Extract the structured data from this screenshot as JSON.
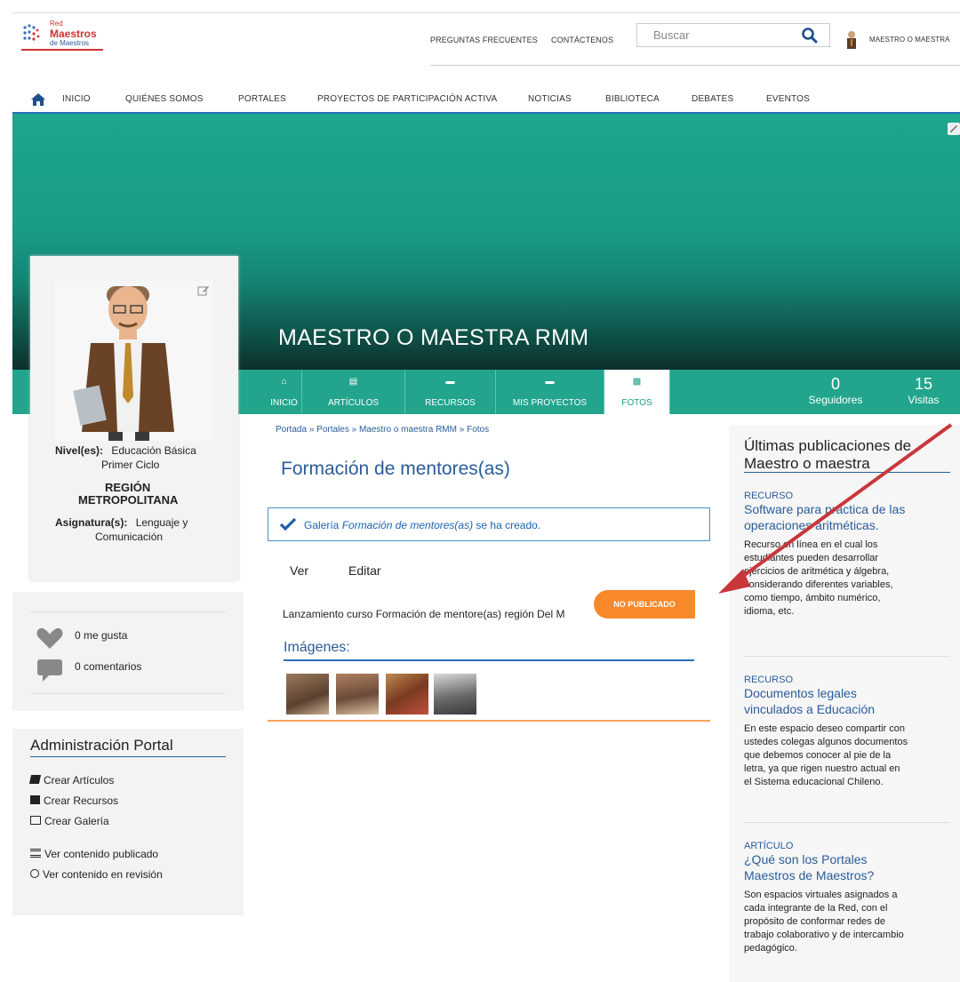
{
  "logo": {
    "line1": "Red",
    "line2": "Maestros",
    "line3": "de Maestros"
  },
  "top_links": {
    "faq": "PREGUNTAS FRECUENTES",
    "contact": "CONTÁCTENOS",
    "user": "MAESTRO O MAESTRA"
  },
  "search": {
    "placeholder": "Buscar"
  },
  "nav": [
    "INICIO",
    "QUIÉNES SOMOS",
    "PORTALES",
    "PROYECTOS DE PARTICIPACIÓN ACTIVA",
    "NOTICIAS",
    "BIBLIOTECA",
    "DEBATES",
    "EVENTOS"
  ],
  "profile": {
    "name": "MAESTRO O MAESTRA RMM",
    "level_label": "Nivel(es):",
    "level_value": "Educación Básica",
    "level_value2": "Primer Ciclo",
    "region1": "REGIÓN",
    "region2": "METROPOLITANA",
    "subject_label": "Asignatura(s):",
    "subject_value": "Lenguaje y",
    "subject_value2": "Comunicación"
  },
  "tabs": [
    "INICIO",
    "ARTÍCULOS",
    "RECURSOS",
    "MIS PROYECTOS",
    "FOTOS"
  ],
  "stats": {
    "followers_count": "0",
    "followers_label": "Seguidores",
    "visits_count": "15",
    "visits_label": "Visitas"
  },
  "social": {
    "likes": "0 me gusta",
    "comments": "0 comentarios"
  },
  "admin": {
    "title": "Administración Portal",
    "create_articles": "Crear Artículos",
    "create_resources": "Crear Recursos",
    "create_gallery": "Crear Galería",
    "view_published": "Ver contenido publicado",
    "view_review": "Ver contenido en revisión"
  },
  "content": {
    "breadcrumb": "Portada » Portales » Maestro o maestra RMM » Fotos",
    "title": "Formación de mentores(as)",
    "alert_pre": "Galería ",
    "alert_em": "Formación de mentores(as)",
    "alert_post": " se ha creado.",
    "tab_view": "Ver",
    "tab_edit": "Editar",
    "badge": "NO PUBLICADO",
    "description": "Lanzamiento curso Formación de mentore(as) región Del M",
    "images_title": "Imágenes:"
  },
  "latest": {
    "title1": "Últimas publicaciones de",
    "title2": "Maestro o maestra",
    "items": [
      {
        "type": "RECURSO",
        "title1": "Software para práctica de las",
        "title2": "operaciones aritméticas.",
        "body": [
          "Recurso en línea en el cual los",
          "estudiantes pueden desarrollar",
          "ejercicios de aritmética y álgebra,",
          "considerando diferentes variables,",
          "como tiempo, ámbito numérico,",
          "idioma, etc."
        ]
      },
      {
        "type": "RECURSO",
        "title1": "Documentos legales",
        "title2": "vinculados a Educación",
        "body": [
          "En este espacio deseo compartir con",
          "ustedes colegas algunos documentos",
          "que debemos conocer al pie de la",
          "letra, ya que rigen nuestro actual en",
          "el Sistema educacional Chileno."
        ]
      },
      {
        "type": "ARTÍCULO",
        "title1": "¿Qué son los Portales",
        "title2": "Maestros de Maestros?",
        "body": [
          "Son espacios virtuales asignados a",
          "cada integrante de la Red, con el",
          "propósito de conformar redes de",
          "trabajo colaborativo y de intercambio",
          "pedagógico."
        ]
      }
    ]
  },
  "colors": {
    "teal": "#1a9c86",
    "blue": "#2a5c9a",
    "orange": "#f7892a",
    "arrow": "#c8373a"
  }
}
